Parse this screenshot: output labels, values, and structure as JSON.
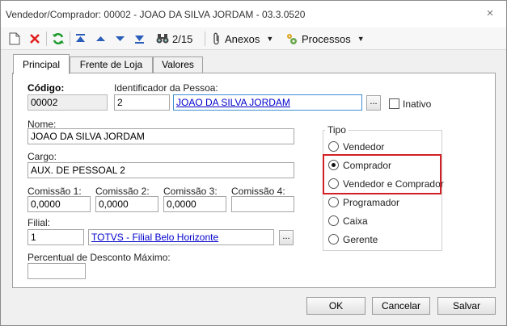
{
  "window": {
    "title": "Vendedor/Comprador: 00002 - JOAO DA SILVA JORDAM - 03.3.0520",
    "close_glyph": "×"
  },
  "toolbar": {
    "record_position": "2/15",
    "anexos_label": "Anexos",
    "processos_label": "Processos",
    "icons": [
      "new-document-icon",
      "delete-icon",
      "refresh-icon",
      "first-record-icon",
      "previous-record-icon",
      "next-record-icon",
      "last-record-icon",
      "binoculars-icon",
      "attachment-icon",
      "processes-icon"
    ],
    "colors": {
      "delete": "#e02020",
      "refresh": "#1a9a2a",
      "nav": "#2a5db8"
    }
  },
  "tabs": [
    {
      "label": "Principal",
      "active": true
    },
    {
      "label": "Frente de Loja",
      "active": false
    },
    {
      "label": "Valores",
      "active": false
    }
  ],
  "form": {
    "codigo": {
      "label": "Código:",
      "value": "00002"
    },
    "identificador": {
      "label": "Identificador da Pessoa:",
      "id_value": "2",
      "name_value": "JOAO DA SILVA JORDAM"
    },
    "inativo": {
      "label": "Inativo",
      "checked": false
    },
    "nome": {
      "label": "Nome:",
      "value": "JOAO DA SILVA JORDAM"
    },
    "cargo": {
      "label": "Cargo:",
      "value": "AUX. DE PESSOAL 2"
    },
    "comissoes": [
      {
        "label": "Comissão 1:",
        "value": "0,0000"
      },
      {
        "label": "Comissão 2:",
        "value": "0,0000"
      },
      {
        "label": "Comissão 3:",
        "value": "0,0000"
      },
      {
        "label": "Comissão 4:",
        "value": ""
      }
    ],
    "filial": {
      "label": "Filial:",
      "code": "1",
      "name": "TOTVS - Filial Belo Horizonte"
    },
    "percentual": {
      "label": "Percentual de Desconto Máximo:",
      "value": ""
    },
    "ellipsis": "..."
  },
  "tipo": {
    "title": "Tipo",
    "options": [
      {
        "label": "Vendedor",
        "selected": false
      },
      {
        "label": "Comprador",
        "selected": true
      },
      {
        "label": "Vendedor e Comprador",
        "selected": false
      },
      {
        "label": "Programador",
        "selected": false
      },
      {
        "label": "Caixa",
        "selected": false
      },
      {
        "label": "Gerente",
        "selected": false
      }
    ],
    "highlight_color": "#d21f25"
  },
  "buttons": {
    "ok": "OK",
    "cancelar": "Cancelar",
    "salvar": "Salvar"
  }
}
